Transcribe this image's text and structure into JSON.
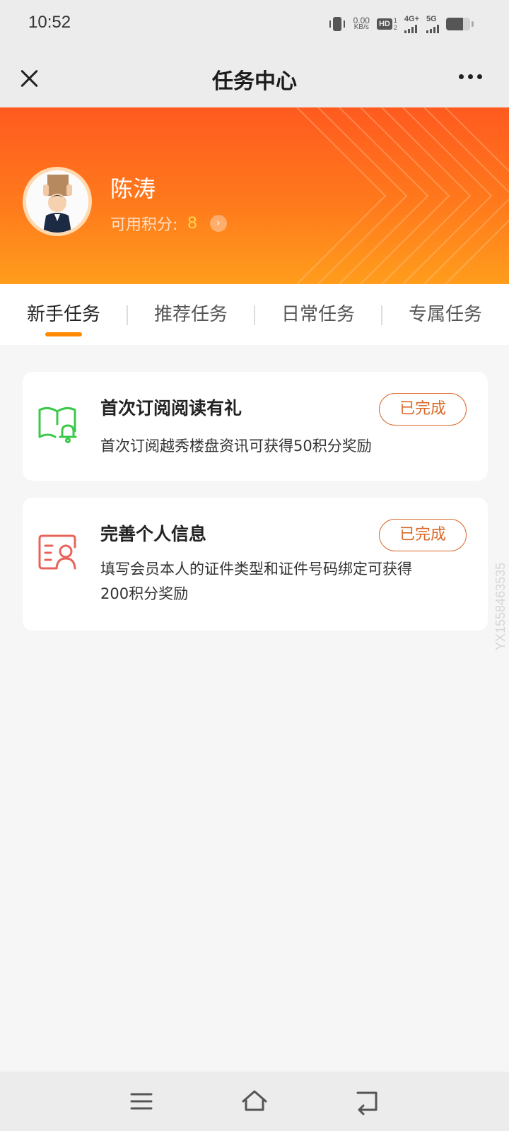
{
  "status_bar": {
    "time": "10:52",
    "net_speed_value": "0.00",
    "net_speed_unit": "KB/s",
    "hd_label": "HD",
    "hd_sub": "1\n2",
    "signal1_label": "4G+",
    "signal2_label": "5G",
    "battery_level": 0.7
  },
  "header": {
    "title": "任务中心",
    "close_icon": "close-icon",
    "more_icon": "more-icon"
  },
  "profile": {
    "name": "陈涛",
    "points_label": "可用积分:",
    "points_value": "8",
    "accent": "#ff6a1c"
  },
  "tabs": [
    {
      "label": "新手任务",
      "active": true
    },
    {
      "label": "推荐任务",
      "active": false
    },
    {
      "label": "日常任务",
      "active": false
    },
    {
      "label": "专属任务",
      "active": false
    }
  ],
  "tasks": [
    {
      "title": "首次订阅阅读有礼",
      "description": "首次订阅越秀楼盘资讯可获得50积分奖励",
      "status": "已完成",
      "icon": "book-bell-icon",
      "icon_color": "#3bc94a"
    },
    {
      "title": "完善个人信息",
      "description": "填写会员本人的证件类型和证件号码绑定可获得200积分奖励",
      "status": "已完成",
      "icon": "id-card-icon",
      "icon_color": "#e8645a"
    }
  ],
  "watermark": "YX1558463535",
  "nav": {
    "menu_icon": "menu-icon",
    "home_icon": "home-icon",
    "back_icon": "back-icon"
  }
}
